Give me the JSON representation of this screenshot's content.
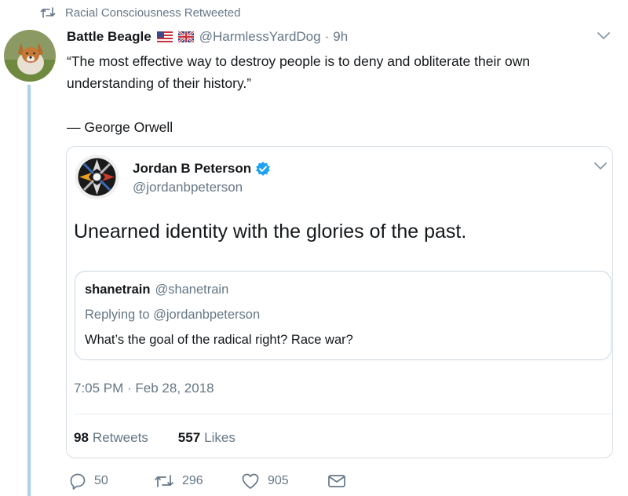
{
  "retweet_context": {
    "text": "Racial Consciousness Retweeted"
  },
  "tweet": {
    "author_name": "Battle Beagle",
    "handle": "@HarmlessYardDog",
    "separator": "·",
    "time_ago": "9h",
    "text": "“The most effective way to destroy people is to deny and obliterate their own\nunderstanding of their history.”\n\n— George Orwell"
  },
  "quoted_tweet": {
    "author_name": "Jordan B Peterson",
    "handle": "@jordanbpeterson",
    "text": "Unearned identity with the glories of the past.",
    "reply": {
      "author_name": "shanetrain",
      "handle": "@shanetrain",
      "replying_to": "Replying to @jordanbpeterson",
      "text": "What’s the goal of the radical right? Race war?"
    },
    "timestamp": "7:05 PM · Feb 28, 2018",
    "stats": {
      "retweets_count": "98",
      "retweets_label": "Retweets",
      "likes_count": "557",
      "likes_label": "Likes"
    }
  },
  "actions": {
    "reply_count": "50",
    "retweet_count": "296",
    "like_count": "905"
  },
  "icons": [
    "retweet-icon",
    "chevron-down-icon",
    "verified-badge-icon",
    "reply-icon",
    "like-icon",
    "direct-message-icon",
    "us-flag-icon",
    "uk-flag-icon"
  ],
  "colors": {
    "accent": "#1da1f2",
    "text": "#14171a",
    "muted": "#657786",
    "thread": "#aad0ef"
  }
}
